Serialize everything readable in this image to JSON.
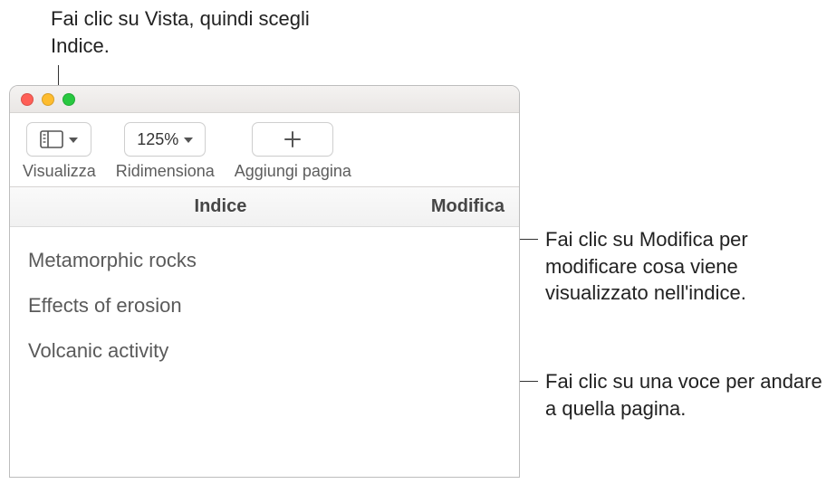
{
  "callouts": {
    "top": "Fai clic su Vista, quindi scegli Indice.",
    "right1": "Fai clic su Modifica per modificare cosa viene visualizzato nell'indice.",
    "right2": "Fai clic su una voce per andare a quella pagina."
  },
  "toolbar": {
    "view_label": "Visualizza",
    "zoom_value": "125%",
    "zoom_label": "Ridimensiona",
    "addpage_label": "Aggiungi pagina"
  },
  "panel": {
    "title": "Indice",
    "edit": "Modifica"
  },
  "toc": {
    "items": [
      {
        "label": "Metamorphic rocks"
      },
      {
        "label": "Effects of erosion"
      },
      {
        "label": "Volcanic activity"
      }
    ]
  },
  "colors": {
    "border": "#bdbdbd",
    "text_gray": "#5d5d5d"
  }
}
